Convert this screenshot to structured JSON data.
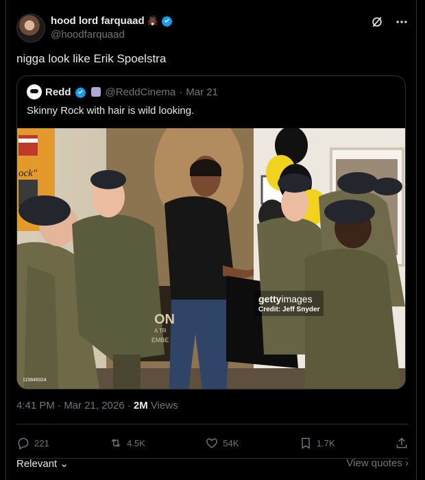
{
  "tweet": {
    "display_name": "hood lord farquaad",
    "name_emoji": "🧛🏿",
    "handle": "@hoodfarquaad",
    "text": "nigga look like Erik Spoelstra",
    "time": "4:41 PM · Mar 21, 2026 · ",
    "views_count": "2M",
    "views_label": " Views"
  },
  "quote": {
    "name": "Redd",
    "handle": "@ReddCinema",
    "separator": "·",
    "date": "Mar 21",
    "text": "Skinny Rock with hair is wild looking."
  },
  "photo": {
    "getty_brand_bold": "getty",
    "getty_brand_light": "images",
    "credit": "Credit: Jeff Snyder",
    "photo_id": "115848324",
    "poster_text_1": "ock\"",
    "poster_text_2": "ON",
    "poster_text_3": "A TR",
    "poster_text_4": "EMBE"
  },
  "actions": {
    "replies": "221",
    "reposts": "4.5K",
    "likes": "54K",
    "bookmarks": "1.7K"
  },
  "footer": {
    "sort": "Relevant",
    "view_quotes": "View quotes"
  },
  "colors": {
    "background": "#000000",
    "text": "#e7e9ea",
    "muted": "#71767b",
    "verified": "#1d9bf0"
  }
}
